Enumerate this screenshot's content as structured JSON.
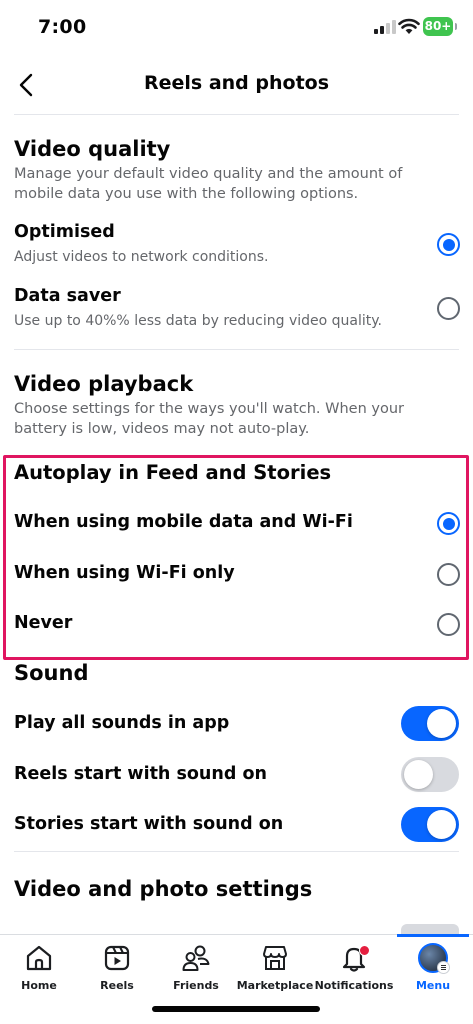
{
  "status": {
    "time": "7:00",
    "battery": "80+"
  },
  "header": {
    "title": "Reels and photos"
  },
  "video_quality": {
    "title": "Video quality",
    "description": "Manage your default video quality and the amount of mobile data you use with the following options.",
    "options": [
      {
        "label": "Optimised",
        "sublabel": "Adjust videos to network conditions.",
        "selected": true
      },
      {
        "label": "Data saver",
        "sublabel": "Use up to 40%% less data by reducing video quality.",
        "selected": false
      }
    ]
  },
  "video_playback": {
    "title": "Video playback",
    "description": "Choose settings for the ways you'll watch. When your battery is low, videos may not auto-play."
  },
  "autoplay": {
    "title": "Autoplay in Feed and Stories",
    "options": [
      {
        "label": "When using mobile data and Wi-Fi",
        "selected": true
      },
      {
        "label": "When using Wi-Fi only",
        "selected": false
      },
      {
        "label": "Never",
        "selected": false
      }
    ]
  },
  "sound": {
    "title": "Sound",
    "toggles": [
      {
        "label": "Play all sounds in app",
        "on": true
      },
      {
        "label": "Reels start with sound on",
        "on": false
      },
      {
        "label": "Stories start with sound on",
        "on": true
      }
    ]
  },
  "video_photo_settings": {
    "title": "Video and photo settings"
  },
  "nav": {
    "items": [
      {
        "label": "Home",
        "icon": "home-icon"
      },
      {
        "label": "Reels",
        "icon": "reels-icon"
      },
      {
        "label": "Friends",
        "icon": "friends-icon"
      },
      {
        "label": "Marketplace",
        "icon": "marketplace-icon"
      },
      {
        "label": "Notifications",
        "icon": "bell-icon"
      },
      {
        "label": "Menu",
        "icon": "avatar"
      }
    ],
    "active": "Menu"
  },
  "colors": {
    "accent": "#0866ff",
    "highlight": "#e01560",
    "badge": "#e41e3f"
  }
}
